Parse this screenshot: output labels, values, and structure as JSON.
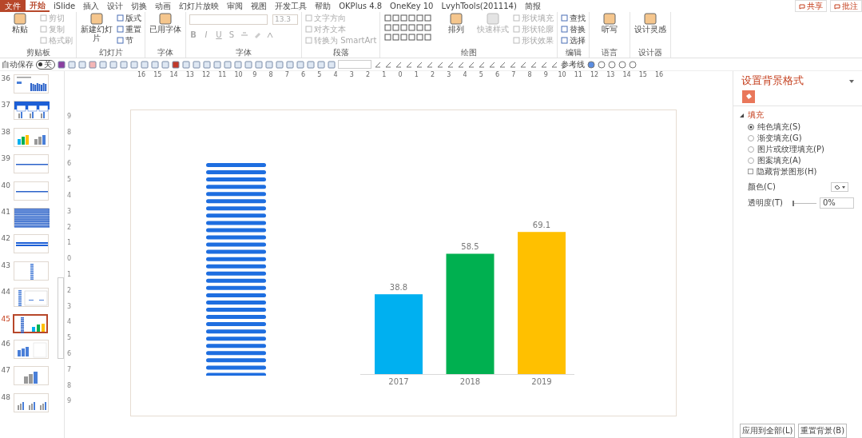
{
  "tabs": [
    {
      "label": "文件",
      "kind": "file",
      "selected": false
    },
    {
      "label": "开始",
      "kind": "tab",
      "selected": true
    },
    {
      "label": "iSlide",
      "kind": "tab",
      "selected": false
    },
    {
      "label": "插入",
      "kind": "tab",
      "selected": false
    },
    {
      "label": "设计",
      "kind": "tab",
      "selected": false
    },
    {
      "label": "切换",
      "kind": "tab",
      "selected": false
    },
    {
      "label": "动画",
      "kind": "tab",
      "selected": false
    },
    {
      "label": "幻灯片放映",
      "kind": "tab",
      "selected": false
    },
    {
      "label": "审阅",
      "kind": "tab",
      "selected": false
    },
    {
      "label": "视图",
      "kind": "tab",
      "selected": false
    },
    {
      "label": "开发工具",
      "kind": "tab",
      "selected": false
    },
    {
      "label": "帮助",
      "kind": "tab",
      "selected": false
    },
    {
      "label": "OKPlus 4.8",
      "kind": "tab",
      "selected": false
    },
    {
      "label": "OneKey 10",
      "kind": "tab",
      "selected": false
    },
    {
      "label": "LvyhTools(201114)",
      "kind": "tab",
      "selected": false
    },
    {
      "label": "简报",
      "kind": "tab",
      "selected": false
    }
  ],
  "header_buttons": [
    "共享",
    "批注"
  ],
  "ribbon": {
    "groups": [
      {
        "label": "剪贴板",
        "items": [
          {
            "kind": "large",
            "label": "粘贴",
            "disabled": false
          },
          {
            "kind": "small",
            "label": "剪切",
            "disabled": true
          },
          {
            "kind": "small",
            "label": "复制",
            "disabled": true
          },
          {
            "kind": "small",
            "label": "格式刷",
            "disabled": true
          }
        ]
      },
      {
        "label": "幻灯片",
        "items": [
          {
            "kind": "large",
            "label": "新建幻灯片",
            "disabled": false
          },
          {
            "kind": "small",
            "label": "版式",
            "disabled": false
          },
          {
            "kind": "small",
            "label": "重置",
            "disabled": false
          },
          {
            "kind": "small",
            "label": "节",
            "disabled": false
          }
        ]
      },
      {
        "label": "字体",
        "items": [
          {
            "kind": "large",
            "label": "已用字体",
            "disabled": false
          }
        ]
      },
      {
        "label": "字体",
        "items": [
          {
            "kind": "fonts",
            "size": "13.3",
            "styles": [
              "B",
              "I",
              "U",
              "S"
            ]
          }
        ]
      },
      {
        "label": "段落",
        "items": [
          {
            "kind": "small",
            "label": "文字方向",
            "disabled": true
          },
          {
            "kind": "small",
            "label": "对齐文本",
            "disabled": true
          },
          {
            "kind": "small",
            "label": "转换为 SmartArt",
            "disabled": true
          }
        ]
      },
      {
        "label": "绘图",
        "items": [
          {
            "kind": "shapes"
          },
          {
            "kind": "large",
            "label": "排列",
            "disabled": false
          },
          {
            "kind": "large",
            "label": "快速样式",
            "disabled": true
          },
          {
            "kind": "small",
            "label": "形状填充",
            "disabled": true
          },
          {
            "kind": "small",
            "label": "形状轮廓",
            "disabled": true
          },
          {
            "kind": "small",
            "label": "形状效果",
            "disabled": true
          }
        ]
      },
      {
        "label": "编辑",
        "items": [
          {
            "kind": "small",
            "label": "查找",
            "disabled": false
          },
          {
            "kind": "small",
            "label": "替换",
            "disabled": false
          },
          {
            "kind": "small",
            "label": "选择",
            "disabled": false
          }
        ]
      },
      {
        "label": "语言",
        "items": [
          {
            "kind": "large",
            "label": "听写",
            "disabled": false
          }
        ]
      },
      {
        "label": "设计器",
        "items": [
          {
            "kind": "large",
            "label": "设计灵感",
            "disabled": false
          }
        ]
      }
    ]
  },
  "quick_access": {
    "autosave_label": "自动保存",
    "autosave": {
      "on": false,
      "label": "关"
    },
    "guides_label": "参考线"
  },
  "ruler": {
    "horizontal": [
      "16",
      "15",
      "14",
      "13",
      "12",
      "11",
      "10",
      "9",
      "8",
      "7",
      "6",
      "5",
      "4",
      "3",
      "2",
      "1",
      "0",
      "1",
      "2",
      "3",
      "4",
      "5",
      "6",
      "7",
      "8",
      "9",
      "10",
      "11",
      "12",
      "13",
      "14",
      "15",
      "16"
    ],
    "vertical": [
      "9",
      "8",
      "7",
      "6",
      "5",
      "4",
      "3",
      "2",
      "1",
      "0",
      "1",
      "2",
      "3",
      "4",
      "5",
      "6",
      "7",
      "8",
      "9"
    ]
  },
  "slides": [
    {
      "number": "36",
      "kind": "report",
      "selected": false
    },
    {
      "number": "37",
      "kind": "cards",
      "selected": false
    },
    {
      "number": "38",
      "kind": "color-bars",
      "selected": false
    },
    {
      "number": "39",
      "kind": "line",
      "selected": false
    },
    {
      "number": "40",
      "kind": "line",
      "selected": false
    },
    {
      "number": "41",
      "kind": "stripes",
      "selected": false
    },
    {
      "number": "42",
      "kind": "band",
      "selected": false
    },
    {
      "number": "43",
      "kind": "stripe-column",
      "selected": false
    },
    {
      "number": "44",
      "kind": "stripe-panels",
      "selected": false
    },
    {
      "number": "45",
      "kind": "stripe-bars",
      "selected": true
    },
    {
      "number": "46",
      "kind": "bars-table",
      "selected": false
    },
    {
      "number": "47",
      "kind": "gray-bars",
      "selected": false
    },
    {
      "number": "48",
      "kind": "bar-groups",
      "selected": false
    }
  ],
  "slide": {
    "chart_data": {
      "type": "bar",
      "categories": [
        "2017",
        "2018",
        "2019"
      ],
      "stacked": true,
      "data_labels": true,
      "series": [
        {
          "color": "#00b0f0",
          "values": [
            38.8,
            null,
            null
          ]
        },
        {
          "color": "#00b050",
          "values": [
            null,
            58.5,
            null
          ]
        },
        {
          "color": "#ffc000",
          "values": [
            null,
            null,
            69.1
          ]
        }
      ]
    }
  },
  "format_pane": {
    "title": "设置背景格式",
    "section": {
      "label": "填充",
      "expanded": true
    },
    "fill_options": [
      {
        "label": "纯色填充(S)",
        "selected": true
      },
      {
        "label": "渐变填充(G)",
        "selected": false
      },
      {
        "label": "图片或纹理填充(P)",
        "selected": false
      },
      {
        "label": "图案填充(A)",
        "selected": false
      }
    ],
    "hide_graphics": {
      "label": "隐藏背景图形(H)",
      "checked": false
    },
    "color_label": "颜色(C)",
    "transparency_label": "透明度(T)",
    "transparency": {
      "level": 0,
      "value": "0%"
    },
    "buttons": [
      "应用到全部(L)",
      "重置背景(B)"
    ]
  }
}
